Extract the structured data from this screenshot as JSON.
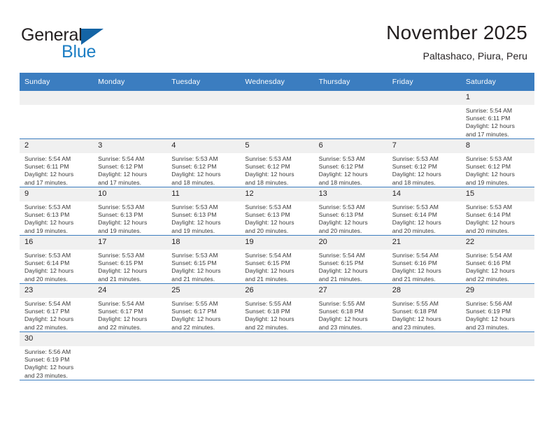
{
  "brand": {
    "name_part1": "General",
    "name_part2": "Blue",
    "flag_icon": "triangle-flag-icon",
    "accent_color": "#1464a5",
    "blue_text_color": "#1c7ec4"
  },
  "header": {
    "month_title": "November 2025",
    "location": "Paltashaco, Piura, Peru"
  },
  "theme": {
    "header_row_bg": "#3b7dc0",
    "daynum_strip_bg": "#f0f0f0",
    "grid_line": "#3b7dc0",
    "text": "#231f20"
  },
  "weekdays": [
    {
      "label": "Sunday"
    },
    {
      "label": "Monday"
    },
    {
      "label": "Tuesday"
    },
    {
      "label": "Wednesday"
    },
    {
      "label": "Thursday"
    },
    {
      "label": "Friday"
    },
    {
      "label": "Saturday"
    }
  ],
  "weeks": [
    [
      {
        "day": "",
        "blank": true,
        "lines": []
      },
      {
        "day": "",
        "blank": true,
        "lines": []
      },
      {
        "day": "",
        "blank": true,
        "lines": []
      },
      {
        "day": "",
        "blank": true,
        "lines": []
      },
      {
        "day": "",
        "blank": true,
        "lines": []
      },
      {
        "day": "",
        "blank": true,
        "lines": []
      },
      {
        "day": "1",
        "blank": false,
        "lines": [
          "Sunrise: 5:54 AM",
          "Sunset: 6:11 PM",
          "Daylight: 12 hours",
          "and 17 minutes."
        ]
      }
    ],
    [
      {
        "day": "2",
        "blank": false,
        "lines": [
          "Sunrise: 5:54 AM",
          "Sunset: 6:11 PM",
          "Daylight: 12 hours",
          "and 17 minutes."
        ]
      },
      {
        "day": "3",
        "blank": false,
        "lines": [
          "Sunrise: 5:54 AM",
          "Sunset: 6:12 PM",
          "Daylight: 12 hours",
          "and 17 minutes."
        ]
      },
      {
        "day": "4",
        "blank": false,
        "lines": [
          "Sunrise: 5:53 AM",
          "Sunset: 6:12 PM",
          "Daylight: 12 hours",
          "and 18 minutes."
        ]
      },
      {
        "day": "5",
        "blank": false,
        "lines": [
          "Sunrise: 5:53 AM",
          "Sunset: 6:12 PM",
          "Daylight: 12 hours",
          "and 18 minutes."
        ]
      },
      {
        "day": "6",
        "blank": false,
        "lines": [
          "Sunrise: 5:53 AM",
          "Sunset: 6:12 PM",
          "Daylight: 12 hours",
          "and 18 minutes."
        ]
      },
      {
        "day": "7",
        "blank": false,
        "lines": [
          "Sunrise: 5:53 AM",
          "Sunset: 6:12 PM",
          "Daylight: 12 hours",
          "and 18 minutes."
        ]
      },
      {
        "day": "8",
        "blank": false,
        "lines": [
          "Sunrise: 5:53 AM",
          "Sunset: 6:12 PM",
          "Daylight: 12 hours",
          "and 19 minutes."
        ]
      }
    ],
    [
      {
        "day": "9",
        "blank": false,
        "lines": [
          "Sunrise: 5:53 AM",
          "Sunset: 6:13 PM",
          "Daylight: 12 hours",
          "and 19 minutes."
        ]
      },
      {
        "day": "10",
        "blank": false,
        "lines": [
          "Sunrise: 5:53 AM",
          "Sunset: 6:13 PM",
          "Daylight: 12 hours",
          "and 19 minutes."
        ]
      },
      {
        "day": "11",
        "blank": false,
        "lines": [
          "Sunrise: 5:53 AM",
          "Sunset: 6:13 PM",
          "Daylight: 12 hours",
          "and 19 minutes."
        ]
      },
      {
        "day": "12",
        "blank": false,
        "lines": [
          "Sunrise: 5:53 AM",
          "Sunset: 6:13 PM",
          "Daylight: 12 hours",
          "and 20 minutes."
        ]
      },
      {
        "day": "13",
        "blank": false,
        "lines": [
          "Sunrise: 5:53 AM",
          "Sunset: 6:13 PM",
          "Daylight: 12 hours",
          "and 20 minutes."
        ]
      },
      {
        "day": "14",
        "blank": false,
        "lines": [
          "Sunrise: 5:53 AM",
          "Sunset: 6:14 PM",
          "Daylight: 12 hours",
          "and 20 minutes."
        ]
      },
      {
        "day": "15",
        "blank": false,
        "lines": [
          "Sunrise: 5:53 AM",
          "Sunset: 6:14 PM",
          "Daylight: 12 hours",
          "and 20 minutes."
        ]
      }
    ],
    [
      {
        "day": "16",
        "blank": false,
        "lines": [
          "Sunrise: 5:53 AM",
          "Sunset: 6:14 PM",
          "Daylight: 12 hours",
          "and 20 minutes."
        ]
      },
      {
        "day": "17",
        "blank": false,
        "lines": [
          "Sunrise: 5:53 AM",
          "Sunset: 6:15 PM",
          "Daylight: 12 hours",
          "and 21 minutes."
        ]
      },
      {
        "day": "18",
        "blank": false,
        "lines": [
          "Sunrise: 5:53 AM",
          "Sunset: 6:15 PM",
          "Daylight: 12 hours",
          "and 21 minutes."
        ]
      },
      {
        "day": "19",
        "blank": false,
        "lines": [
          "Sunrise: 5:54 AM",
          "Sunset: 6:15 PM",
          "Daylight: 12 hours",
          "and 21 minutes."
        ]
      },
      {
        "day": "20",
        "blank": false,
        "lines": [
          "Sunrise: 5:54 AM",
          "Sunset: 6:15 PM",
          "Daylight: 12 hours",
          "and 21 minutes."
        ]
      },
      {
        "day": "21",
        "blank": false,
        "lines": [
          "Sunrise: 5:54 AM",
          "Sunset: 6:16 PM",
          "Daylight: 12 hours",
          "and 21 minutes."
        ]
      },
      {
        "day": "22",
        "blank": false,
        "lines": [
          "Sunrise: 5:54 AM",
          "Sunset: 6:16 PM",
          "Daylight: 12 hours",
          "and 22 minutes."
        ]
      }
    ],
    [
      {
        "day": "23",
        "blank": false,
        "lines": [
          "Sunrise: 5:54 AM",
          "Sunset: 6:17 PM",
          "Daylight: 12 hours",
          "and 22 minutes."
        ]
      },
      {
        "day": "24",
        "blank": false,
        "lines": [
          "Sunrise: 5:54 AM",
          "Sunset: 6:17 PM",
          "Daylight: 12 hours",
          "and 22 minutes."
        ]
      },
      {
        "day": "25",
        "blank": false,
        "lines": [
          "Sunrise: 5:55 AM",
          "Sunset: 6:17 PM",
          "Daylight: 12 hours",
          "and 22 minutes."
        ]
      },
      {
        "day": "26",
        "blank": false,
        "lines": [
          "Sunrise: 5:55 AM",
          "Sunset: 6:18 PM",
          "Daylight: 12 hours",
          "and 22 minutes."
        ]
      },
      {
        "day": "27",
        "blank": false,
        "lines": [
          "Sunrise: 5:55 AM",
          "Sunset: 6:18 PM",
          "Daylight: 12 hours",
          "and 23 minutes."
        ]
      },
      {
        "day": "28",
        "blank": false,
        "lines": [
          "Sunrise: 5:55 AM",
          "Sunset: 6:18 PM",
          "Daylight: 12 hours",
          "and 23 minutes."
        ]
      },
      {
        "day": "29",
        "blank": false,
        "lines": [
          "Sunrise: 5:56 AM",
          "Sunset: 6:19 PM",
          "Daylight: 12 hours",
          "and 23 minutes."
        ]
      }
    ],
    [
      {
        "day": "30",
        "blank": false,
        "lines": [
          "Sunrise: 5:56 AM",
          "Sunset: 6:19 PM",
          "Daylight: 12 hours",
          "and 23 minutes."
        ]
      },
      {
        "day": "",
        "blank": true,
        "lines": []
      },
      {
        "day": "",
        "blank": true,
        "lines": []
      },
      {
        "day": "",
        "blank": true,
        "lines": []
      },
      {
        "day": "",
        "blank": true,
        "lines": []
      },
      {
        "day": "",
        "blank": true,
        "lines": []
      },
      {
        "day": "",
        "blank": true,
        "lines": []
      }
    ]
  ]
}
